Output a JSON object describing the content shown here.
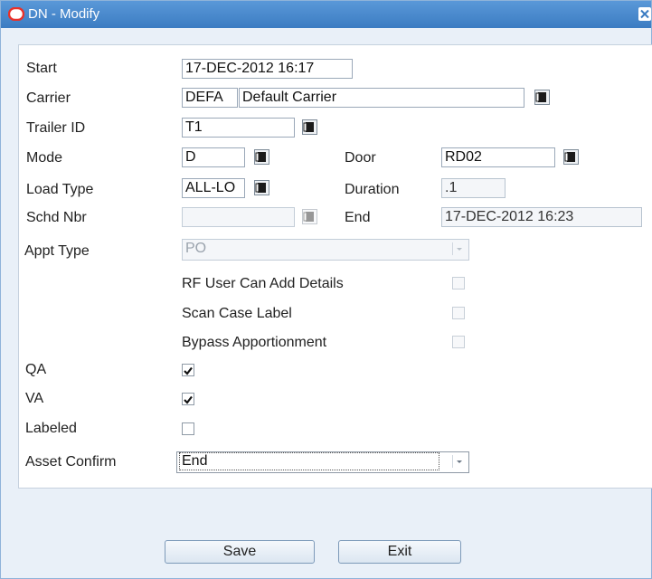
{
  "window": {
    "title": "DN - Modify"
  },
  "form": {
    "start": {
      "label": "Start",
      "value": "17-DEC-2012  16:17"
    },
    "carrier": {
      "label": "Carrier",
      "code": "DEFA",
      "name": "Default Carrier"
    },
    "trailer_id": {
      "label": "Trailer ID",
      "value": "T1"
    },
    "mode": {
      "label": "Mode",
      "value": "D"
    },
    "door": {
      "label": "Door",
      "value": "RD02"
    },
    "load_type": {
      "label": "Load Type",
      "value": "ALL-LO"
    },
    "duration": {
      "label": "Duration",
      "value": ".1"
    },
    "schd_nbr": {
      "label": "Schd Nbr",
      "value": ""
    },
    "end": {
      "label": "End",
      "value": "17-DEC-2012  16:23"
    },
    "appt_type": {
      "label": "Appt Type",
      "value": "PO"
    },
    "rf_user_can_add_details": {
      "label": "RF User Can Add Details",
      "checked": false
    },
    "scan_case_label": {
      "label": "Scan Case Label",
      "checked": false
    },
    "bypass_apportionment": {
      "label": "Bypass Apportionment",
      "checked": false
    },
    "qa": {
      "label": "QA",
      "checked": true
    },
    "va": {
      "label": "VA",
      "checked": true
    },
    "labeled": {
      "label": "Labeled",
      "checked": false
    },
    "asset_confirm": {
      "label": "Asset Confirm",
      "value": "End"
    }
  },
  "buttons": {
    "save": "Save",
    "exit": "Exit"
  },
  "colors": {
    "titlebar": "#3b7cc2",
    "logo": "#e8322b",
    "panel_bg": "#e9f0f8"
  }
}
